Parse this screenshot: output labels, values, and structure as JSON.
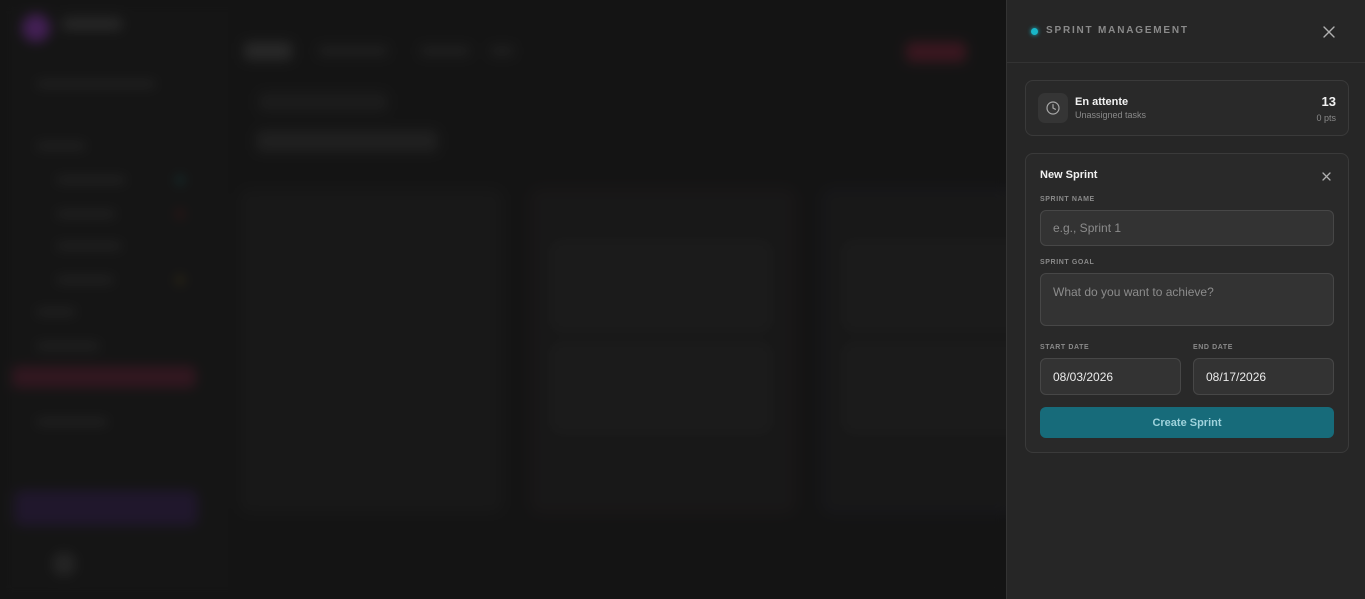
{
  "panel": {
    "title": "SPRINT MANAGEMENT",
    "accent_color": "#19b6c8",
    "close_icon": "close-icon"
  },
  "backlog": {
    "title": "En attente",
    "subtitle": "Unassigned tasks",
    "count": "13",
    "points": "0 pts",
    "icon": "clock-icon"
  },
  "new_sprint": {
    "title": "New Sprint",
    "close_icon": "close-icon",
    "name_label": "SPRINT NAME",
    "name_placeholder": "e.g., Sprint 1",
    "name_value": "",
    "goal_label": "SPRINT GOAL",
    "goal_placeholder": "What do you want to achieve?",
    "goal_value": "",
    "start_label": "START DATE",
    "start_value": "08/03/2026",
    "end_label": "END DATE",
    "end_value": "08/17/2026",
    "submit_label": "Create Sprint",
    "submit_color": "#176b7a"
  }
}
